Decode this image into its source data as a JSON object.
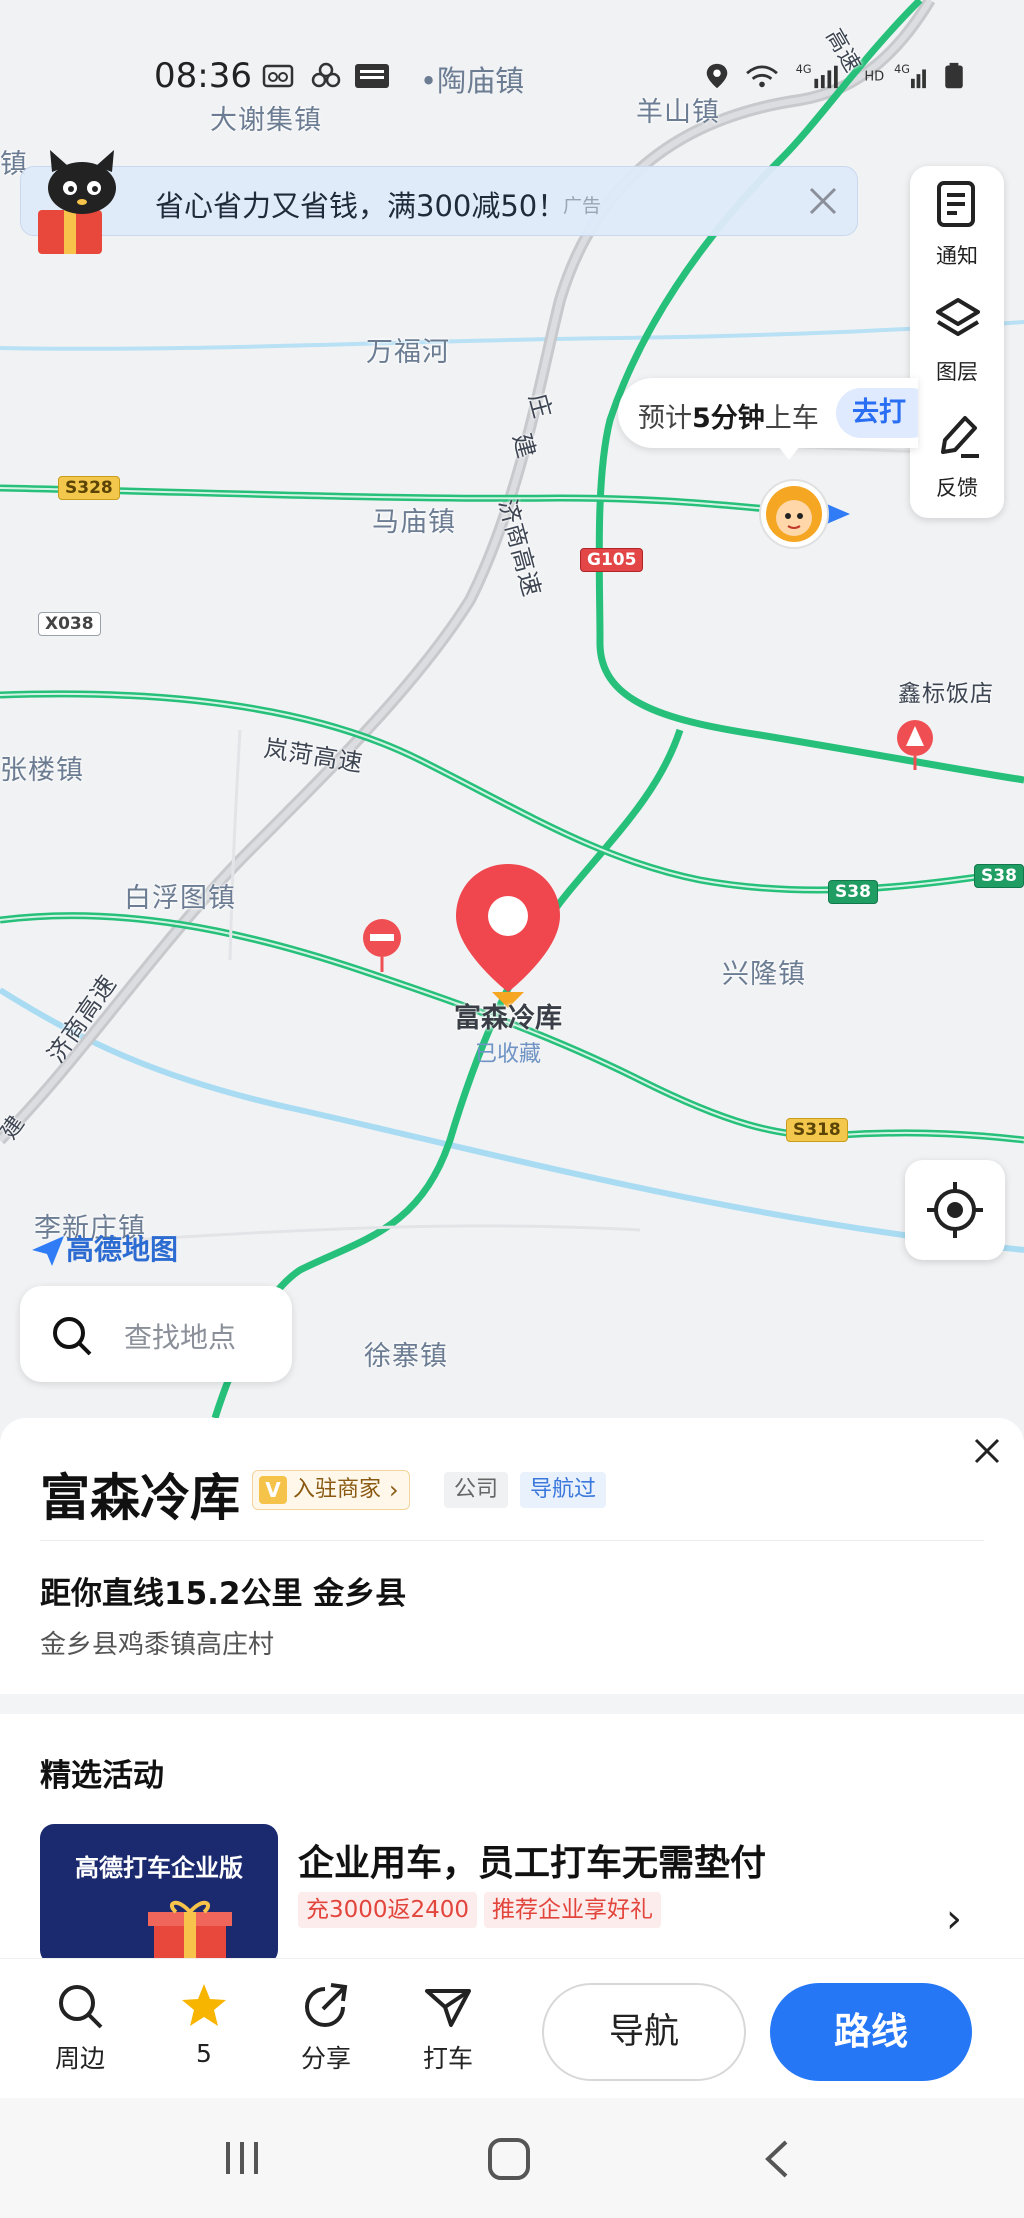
{
  "status_bar": {
    "time": "08:36",
    "location": "•陶庙镇"
  },
  "map": {
    "places": {
      "daxieji": "大谢集镇",
      "yangshan": "羊山镇",
      "wanfu_river": "万福河",
      "mamiao": "马庙镇",
      "zhanglou": "张楼镇",
      "baifutu": "白浮图镇",
      "xinglong": "兴隆镇",
      "lixinzhuang": "李新庄镇",
      "xuzhai": "徐寨镇",
      "xinbiao": "鑫标饭店",
      "zhen_left": "镇"
    },
    "roads": {
      "s328": "S328",
      "g105": "G105",
      "x038": "X038",
      "s38a": "S38",
      "s38b": "S38",
      "s318": "S318",
      "lanhe_expressway": "岚菏高速",
      "jishang_left": "济商高速",
      "jishang_mid": "济商高速",
      "jishang_top": "济商高速",
      "jian_left": "建",
      "jian_mid": "建",
      "zhuang_mid": "庄",
      "zhuang_top": "高速"
    },
    "ad": {
      "text": "省心省力又省钱，满300减50！",
      "tag": "广告"
    },
    "tools": {
      "notify": "通知",
      "layers": "图层",
      "feedback": "反馈"
    },
    "eta": {
      "prefix": "预计",
      "strong": "5分钟",
      "suffix": "上车",
      "go": "去打"
    },
    "poi": {
      "label": "富森冷库",
      "sub": "已收藏"
    },
    "brand": "高德地图",
    "search_placeholder": "查找地点",
    "colors": {
      "expressway": "#b9bcc2",
      "national_road": "#27c07a",
      "river": "#a9dcf3",
      "pin": "#f0464d"
    }
  },
  "sheet": {
    "title": "富森冷库",
    "merchant_badge": "入驻商家",
    "merchant_v": "V",
    "chip_company": "公司",
    "chip_navigated": "导航过",
    "distance_line": "距你直线15.2公里  金乡县",
    "address": "金乡县鸡黍镇高庄村",
    "section_title": "精选活动",
    "promo": {
      "card_text": "高德打车企业版",
      "title": "企业用车，员工打车无需垫付",
      "tag1": "充3000返2400",
      "tag2": "推荐企业享好礼"
    }
  },
  "actions": {
    "nearby": "周边",
    "favorites_count": "5",
    "share": "分享",
    "taxi": "打车",
    "navigate": "导航",
    "route": "路线"
  }
}
